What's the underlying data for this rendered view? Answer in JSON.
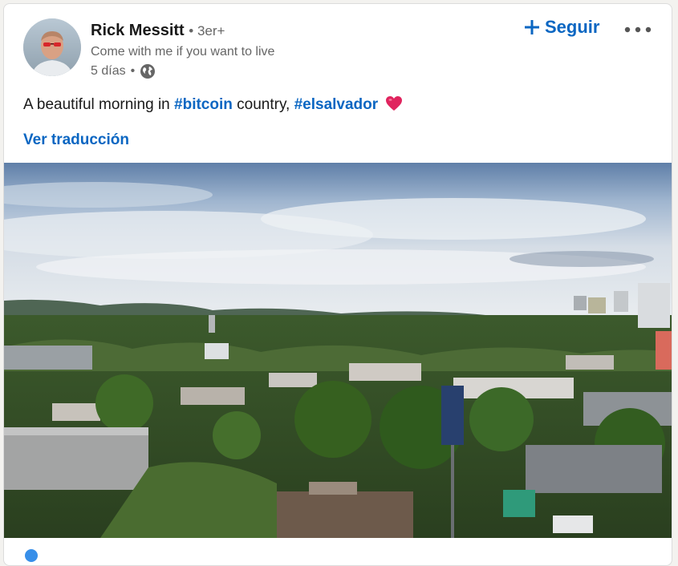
{
  "author": {
    "name": "Rick Messitt",
    "degree": "• 3er+",
    "headline": "Come with me if you want to live",
    "time": "5 días",
    "time_separator": "•",
    "visibility_icon": "globe-icon"
  },
  "actions": {
    "follow_label": "Seguir",
    "follow_icon": "plus-icon",
    "more_icon": "ellipsis-icon"
  },
  "post": {
    "text_part1": "A beautiful morning in ",
    "hashtag1": "#bitcoin",
    "text_part2": " country, ",
    "hashtag2": "#elsalvador",
    "emoji_icon": "heart-icon",
    "translate_label": "Ver traducción"
  },
  "colors": {
    "accent": "#0a66c2",
    "text_primary": "#191919",
    "text_secondary": "#666666",
    "heart": "#e0245e"
  }
}
